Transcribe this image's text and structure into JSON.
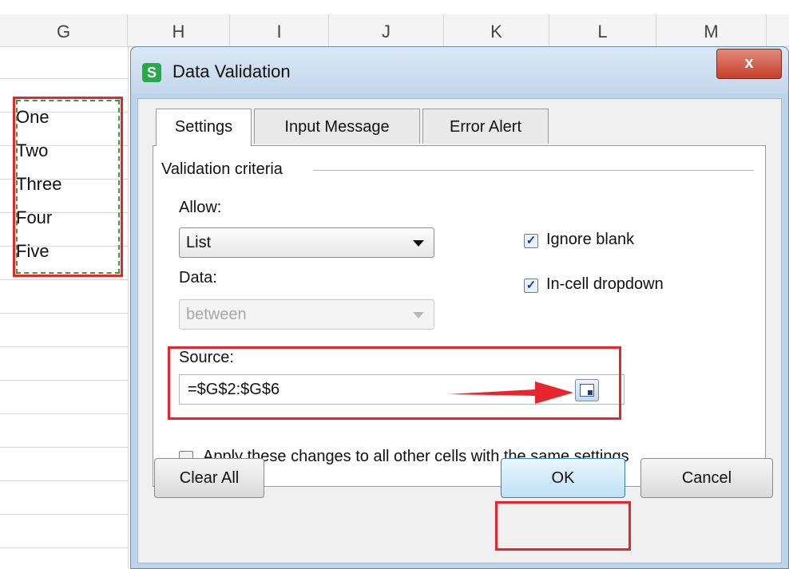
{
  "sheet": {
    "columns": [
      "G",
      "H",
      "I",
      "J",
      "K",
      "L",
      "M"
    ],
    "cells": [
      "One",
      "Two",
      "Three",
      "Four",
      "Five"
    ]
  },
  "dialog": {
    "title": "Data Validation",
    "app_icon": "S",
    "close_icon": "close-icon",
    "close_glyph": "x",
    "tabs": [
      "Settings",
      "Input Message",
      "Error Alert"
    ],
    "active_tab": "Settings",
    "group_label": "Validation criteria",
    "allow_label": "Allow:",
    "allow_value": "List",
    "data_label": "Data:",
    "data_value": "between",
    "ignore_blank_label": "Ignore blank",
    "ignore_blank_checked": true,
    "in_cell_dropdown_label": "In-cell dropdown",
    "in_cell_dropdown_checked": true,
    "source_label": "Source:",
    "source_value": "=$G$2:$G$6",
    "apply_all_label": "Apply these changes to all other cells with the same settings",
    "apply_all_checked": false,
    "buttons": {
      "clear_all": "Clear All",
      "ok": "OK",
      "cancel": "Cancel"
    }
  },
  "annotations": {
    "highlight_color": "#e5262c",
    "marquee_color": "#44953a",
    "arrow_color": "#e5262c"
  }
}
